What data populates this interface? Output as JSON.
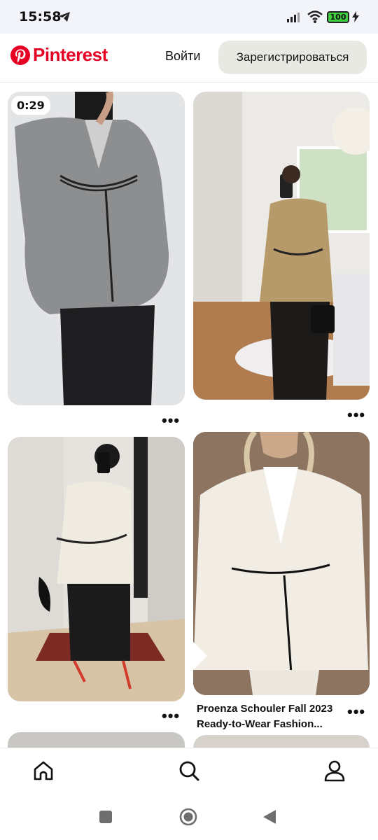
{
  "status_bar": {
    "time": "15:58",
    "battery": "100"
  },
  "header": {
    "logo_text": "Pinterest",
    "login_label": "Войти",
    "signup_label": "Зарегистрироваться"
  },
  "feed": {
    "pins": [
      {
        "id": "grey-blazer",
        "badge": "0:29",
        "more": "•••"
      },
      {
        "id": "beige-blazer",
        "more": "•••"
      },
      {
        "id": "white-blazer-mirror",
        "more": "•••"
      },
      {
        "id": "proenza-runway",
        "title": "Proenza Schouler Fall 2023 Ready-to-Wear Fashion...",
        "more": "•••"
      }
    ]
  },
  "bottom_nav": {
    "items": [
      {
        "icon": "home-icon"
      },
      {
        "icon": "search-icon"
      },
      {
        "icon": "profile-icon"
      }
    ]
  },
  "colors": {
    "brand": "#e60023",
    "signup_bg": "#e9e9e4",
    "statusbar_bg": "#f3f4f9"
  }
}
